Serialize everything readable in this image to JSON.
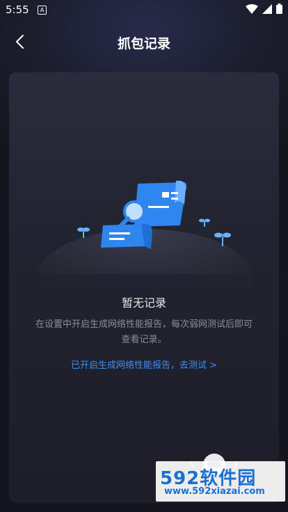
{
  "status_bar": {
    "time": "5:55",
    "notification_letter": "A",
    "icons": [
      "wifi-icon",
      "signal-icon",
      "battery-icon"
    ]
  },
  "header": {
    "title": "抓包记录",
    "back_icon": "chevron-left-icon"
  },
  "empty_state": {
    "illustration": "document-search-illustration",
    "title": "暂无记录",
    "description": "在设置中开启生成网络性能报告，每次弱网测试后即可查看记录。",
    "action_link": "已开启生成网络性能报告，去测试 >"
  },
  "watermark": {
    "line1": "592软件园",
    "line2": "www.592xiazai.com"
  },
  "colors": {
    "background": "#14151e",
    "card": "#222330",
    "accent": "#3d8ff0",
    "illustration_blue": "#2f86f0"
  }
}
